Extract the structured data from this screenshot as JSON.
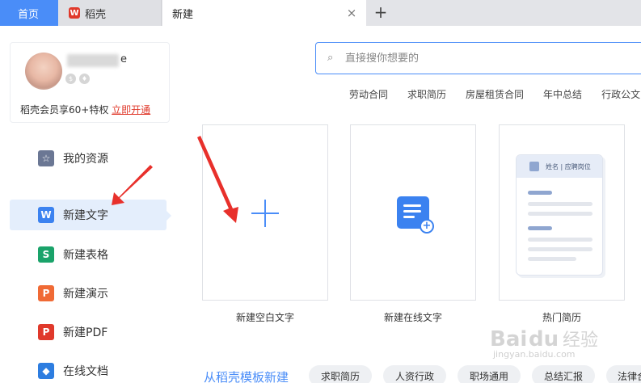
{
  "tabs": {
    "home": "首页",
    "daoke": "稻壳",
    "daoke_logo": "W",
    "new": "新建",
    "close_glyph": "×",
    "add_glyph": "+"
  },
  "user": {
    "name_tail": "e",
    "badge1": "$",
    "badge2": "♦",
    "member_text": "稻壳会员享60+特权",
    "member_link": "立即开通"
  },
  "sidebar": {
    "items": [
      {
        "label": "我的资源",
        "icon": "star-icon",
        "glyph": "☆",
        "color": "#6b7794"
      },
      {
        "label": "新建文字",
        "icon": "wps-writer-icon",
        "glyph": "W",
        "color": "#3b82f0"
      },
      {
        "label": "新建表格",
        "icon": "wps-sheet-icon",
        "glyph": "S",
        "color": "#1aa36a"
      },
      {
        "label": "新建演示",
        "icon": "wps-presentation-icon",
        "glyph": "P",
        "color": "#f06a35"
      },
      {
        "label": "新建PDF",
        "icon": "pdf-icon",
        "glyph": "P",
        "color": "#e0392b"
      },
      {
        "label": "在线文档",
        "icon": "online-doc-icon",
        "glyph": "◆",
        "color": "#2d7de0"
      }
    ],
    "active_index": 1
  },
  "search": {
    "placeholder": "直接搜你想要的",
    "icon_glyph": "⌕"
  },
  "hot_tags": [
    "劳动合同",
    "求职简历",
    "房屋租赁合同",
    "年中总结",
    "行政公文"
  ],
  "cards": [
    {
      "label": "新建空白文字"
    },
    {
      "label": "新建在线文字"
    },
    {
      "label": "热门简历",
      "resume_name": "姓名 | 应聘岗位"
    }
  ],
  "templates": {
    "title": "从稻壳模板新建",
    "tags": [
      "求职简历",
      "人资行政",
      "职场通用",
      "总结汇报",
      "法律合"
    ]
  },
  "watermark": {
    "text": "jingyan.baidu.com"
  },
  "colors": {
    "accent": "#4a8df8",
    "arrow": "#e8302b",
    "active_bg": "#e4eefc"
  }
}
